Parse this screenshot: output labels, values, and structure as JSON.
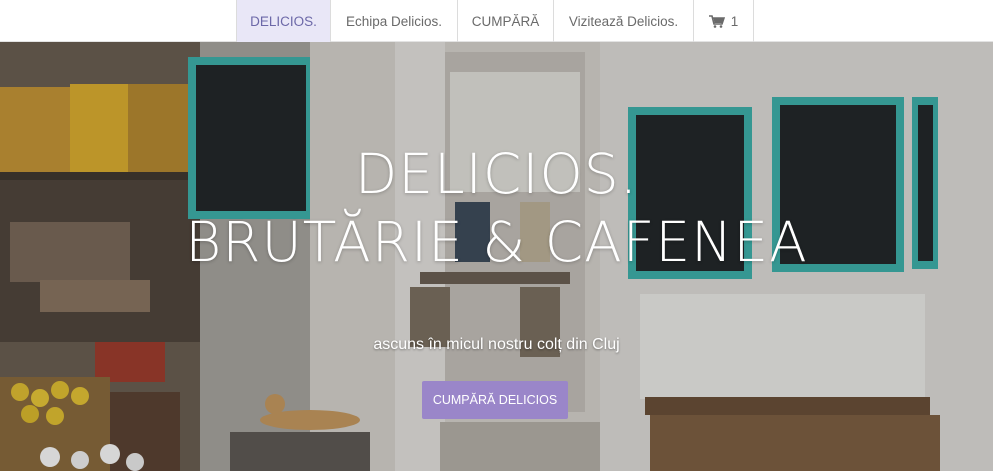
{
  "nav": {
    "items": [
      {
        "label": "DELICIOS.",
        "active": true
      },
      {
        "label": "Echipa Delicios."
      },
      {
        "label": "CUMPĂRĂ"
      },
      {
        "label": "Vizitează Delicios."
      }
    ],
    "cart": {
      "icon": "shopping-cart-icon",
      "count": "1"
    }
  },
  "hero": {
    "title_line1": "DELICIOS.",
    "title_line2": "BRUTĂRIE & CAFENEA",
    "subtitle": "ascuns în micul nostru colț din Cluj",
    "button_label": "CUMPĂRĂ DELICIOS"
  },
  "colors": {
    "accent": "#9a86c9",
    "nav_active_bg": "#e9e7f7",
    "nav_active_text": "#6c68a8",
    "chalkboard_frame": "#3bb3ad"
  }
}
